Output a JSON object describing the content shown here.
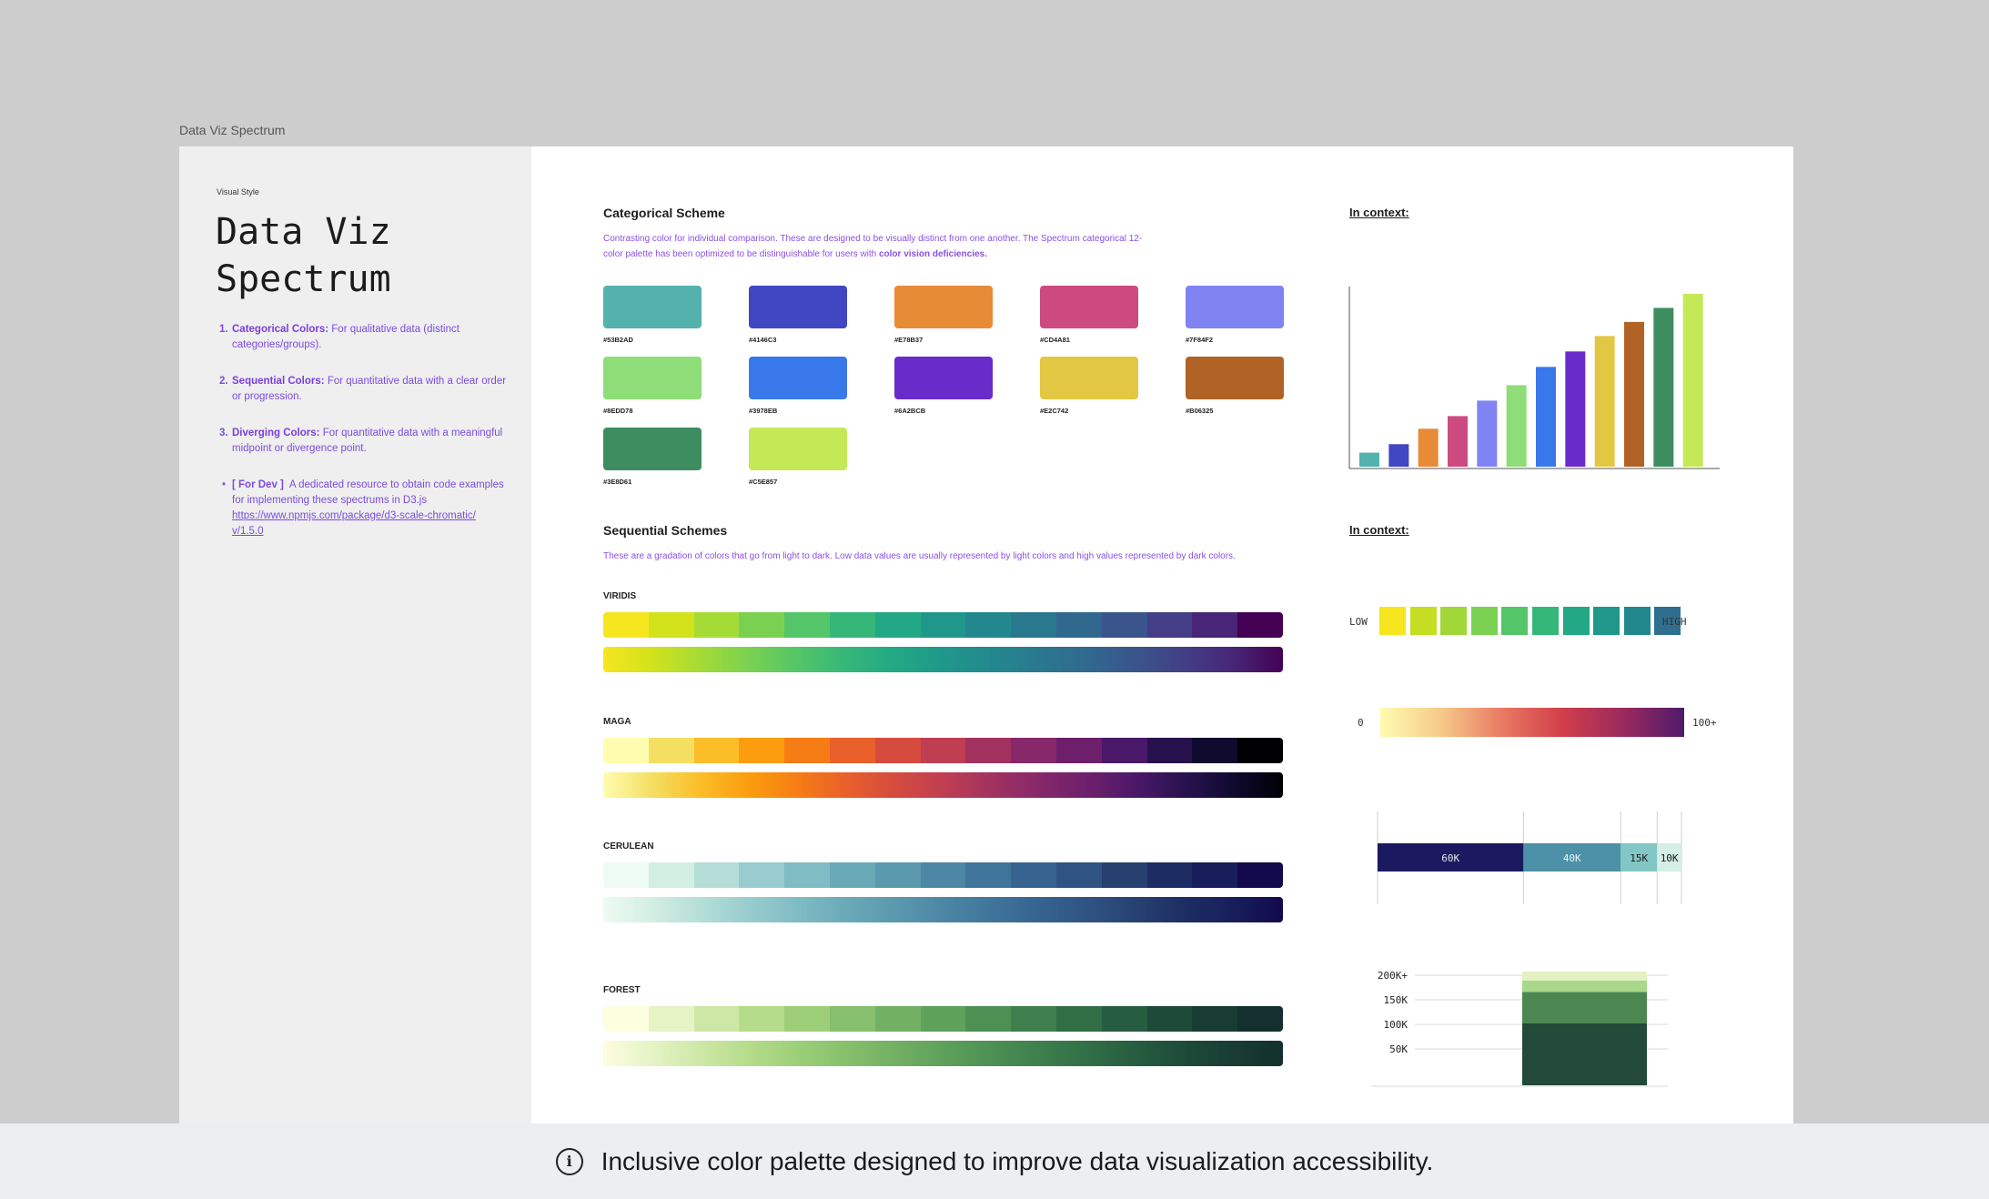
{
  "frame_label": "Data Viz Spectrum",
  "sidebar": {
    "eyebrow": "Visual Style",
    "title_line1": "Data Viz",
    "title_line2": "Spectrum",
    "notes": [
      {
        "num": "1.",
        "term": "Categorical Colors:",
        "text": "For qualitative data (distinct categories/groups)."
      },
      {
        "num": "2.",
        "term": "Sequential Colors:",
        "text": "For quantitative data with a clear order or progression."
      },
      {
        "num": "3.",
        "term": "Diverging Colors:",
        "text": "For quantitative data with a meaningful midpoint or divergence point."
      }
    ],
    "dev": {
      "tag": "[ For Dev ]",
      "text": "A dedicated resource to obtain code examples for implementing these spectrums in D3.js",
      "link_line1": "https://www.npmjs.com/package/d3-scale-chromatic/",
      "link_line2": "v/1.5.0"
    }
  },
  "categorical": {
    "title": "Categorical Scheme",
    "desc_line1": "Contrasting color for individual comparison. These are designed to be visually distinct from one another. The Spectrum categorical 12-",
    "desc_line2": "color palette has been optimized to be distinguishable for users with",
    "desc_bold": "color vision deficiencies.",
    "swatches": [
      {
        "hex": "#53B2AD",
        "label": "#53B2AD"
      },
      {
        "hex": "#4146C3",
        "label": "#4146C3"
      },
      {
        "hex": "#E78B37",
        "label": "#E78B37"
      },
      {
        "hex": "#CD4A81",
        "label": "#CD4A81"
      },
      {
        "hex": "#7F84F2",
        "label": "#7F84F2"
      },
      {
        "hex": "#8EDD78",
        "label": "#8EDD78"
      },
      {
        "hex": "#3978EB",
        "label": "#3978EB"
      },
      {
        "hex": "#6A2BCB",
        "label": "#6A2BCB"
      },
      {
        "hex": "#E2C742",
        "label": "#E2C742"
      },
      {
        "hex": "#B06325",
        "label": "#B06325"
      },
      {
        "hex": "#3E8D61",
        "label": "#3E8D61"
      },
      {
        "hex": "#C5E857",
        "label": "#C5E857"
      }
    ]
  },
  "context_title": "In context:",
  "bar_context": {
    "values": [
      10,
      16,
      27,
      36,
      47,
      58,
      71,
      82,
      93,
      103,
      113,
      123
    ],
    "colors": [
      "#53B2AD",
      "#4146C3",
      "#E78B37",
      "#CD4A81",
      "#7F84F2",
      "#8EDD78",
      "#3978EB",
      "#6A2BCB",
      "#E2C742",
      "#B06325",
      "#3E8D61",
      "#C5E857"
    ]
  },
  "sequential": {
    "title": "Sequential Schemes",
    "desc": "These are a gradation of colors that go from light to dark. Low data values are usually represented by light colors and high values represented by dark colors.",
    "schemes": [
      {
        "name": "VIRIDIS",
        "colors": [
          "#f6e620",
          "#d2e21b",
          "#a5db36",
          "#7ad151",
          "#54c568",
          "#35b779",
          "#22a884",
          "#1f988b",
          "#23888e",
          "#2a788e",
          "#31688e",
          "#3a548c",
          "#433e85",
          "#482576",
          "#440154"
        ]
      },
      {
        "name": "MAGA",
        "colors": [
          "#fffcb0",
          "#f4df63",
          "#fbbd28",
          "#fb9d0e",
          "#f67d15",
          "#e9602b",
          "#d54b3e",
          "#c03e51",
          "#a23260",
          "#86286a",
          "#6d1f6c",
          "#4a1868",
          "#28124e",
          "#0f0a2e",
          "#000004"
        ]
      },
      {
        "name": "CERULEAN",
        "colors": [
          "#eefbf2",
          "#d3eee3",
          "#b5ded8",
          "#98ccce",
          "#7fbcc3",
          "#6aaab8",
          "#5b99ae",
          "#4c87a5",
          "#3f759b",
          "#366390",
          "#2f5383",
          "#264170",
          "#1d2d63",
          "#171e5a",
          "#120a4d"
        ]
      },
      {
        "name": "FOREST",
        "colors": [
          "#fdfde0",
          "#e5f3c5",
          "#cde8a6",
          "#b5dc8b",
          "#9dcf79",
          "#86c06c",
          "#72b063",
          "#5ea15a",
          "#4d9054",
          "#3e7f4d",
          "#316e46",
          "#265c40",
          "#1d4b38",
          "#183c33",
          "#13302e"
        ]
      }
    ]
  },
  "seq_context": {
    "low": "LOW",
    "high": "HIGH",
    "zero": "0",
    "hundred": "100+",
    "squares": [
      "#f6e620",
      "#c5dd22",
      "#a2d73a",
      "#7ad151",
      "#54c568",
      "#35b779",
      "#22a884",
      "#1f988b",
      "#23888e",
      "#2f6e8e"
    ],
    "segments": [
      {
        "label": "60K",
        "color": "#1b1a60",
        "text": "#e8e8f0"
      },
      {
        "label": "40K",
        "color": "#4c91a7",
        "text": "#eaf4f6"
      },
      {
        "label": "15K",
        "color": "#82c7c6",
        "text": "#1a1a1a"
      },
      {
        "label": "10K",
        "color": "#d5eee6",
        "text": "#1a1a1a"
      }
    ],
    "stack_ticks": [
      "200K+",
      "150K",
      "100K",
      "50K"
    ],
    "stack": [
      {
        "value": 70,
        "color": "#234a38"
      },
      {
        "value": 35,
        "color": "#4b8851"
      },
      {
        "value": 13,
        "color": "#a9d88b"
      },
      {
        "value": 10,
        "color": "#e4f1c2"
      }
    ]
  },
  "footer": {
    "icon": "i",
    "message": "Inclusive color palette designed to improve data visualization accessibility."
  }
}
